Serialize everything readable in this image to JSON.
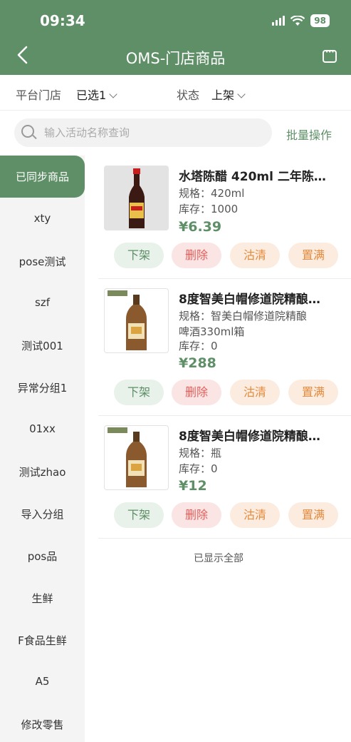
{
  "status_bar": {
    "time": "09:34",
    "battery": "98"
  },
  "header": {
    "title": "OMS-门店商品"
  },
  "filters": {
    "store_label": "平台门店",
    "store_value": "已选1",
    "status_label": "状态",
    "status_value": "上架"
  },
  "search": {
    "placeholder": "输入活动名称查询",
    "batch_label": "批量操作"
  },
  "sidebar": {
    "active": "已同步商品",
    "items": [
      "xty",
      "pose测试",
      "szf",
      "测试001",
      "异常分组1",
      "01xx",
      "测试zhao",
      "导入分组",
      "pos品",
      "生鲜",
      "F食品生鲜",
      "A5",
      "修改零售"
    ]
  },
  "products": [
    {
      "name": "水塔陈醋 420ml 二年陈…",
      "spec_label": "规格：",
      "spec": "420ml",
      "spec_line2": "",
      "stock_label": "库存：",
      "stock": "1000",
      "price": "¥6.39"
    },
    {
      "name": "8度智美白帽修道院精酿…",
      "spec_label": "规格：",
      "spec": "智美白帽修道院精酿",
      "spec_line2": "啤酒330ml箱",
      "stock_label": "库存：",
      "stock": "0",
      "price": "¥288"
    },
    {
      "name": "8度智美白帽修道院精酿…",
      "spec_label": "规格：",
      "spec": "瓶",
      "spec_line2": "",
      "stock_label": "库存：",
      "stock": "0",
      "price": "¥12"
    }
  ],
  "actions": {
    "off": "下架",
    "delete": "删除",
    "clear": "沽清",
    "full": "置满"
  },
  "footer_text": "已显示全部",
  "colors": {
    "brand": "#5e8f67",
    "danger": "#e0605c",
    "warning": "#e48a3c"
  }
}
